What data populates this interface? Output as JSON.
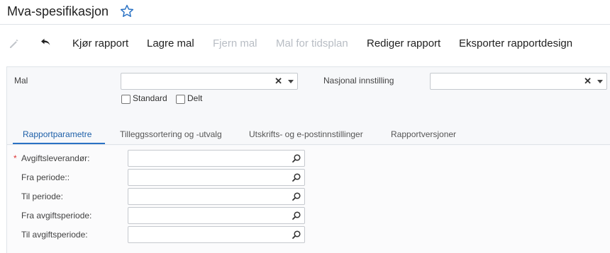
{
  "page": {
    "title": "Mva-spesifikasjon"
  },
  "toolbar": {
    "run": "Kjør rapport",
    "save_template": "Lagre mal",
    "remove_template": "Fjern mal",
    "schedule_template": "Mal for tidsplan",
    "edit_report": "Rediger rapport",
    "export_design": "Eksporter rapportdesign"
  },
  "header_fields": {
    "template_label": "Mal",
    "template_value": "",
    "national_label": "Nasjonal innstilling",
    "national_value": "",
    "standard_label": "Standard",
    "shared_label": "Delt"
  },
  "tabs": [
    {
      "label": "Rapportparametre",
      "active": true
    },
    {
      "label": "Tilleggssortering og -utvalg",
      "active": false
    },
    {
      "label": "Utskrifts- og e-postinnstillinger",
      "active": false
    },
    {
      "label": "Rapportversjoner",
      "active": false
    }
  ],
  "params": [
    {
      "label": "Avgiftsleverandør:",
      "required": true,
      "value": ""
    },
    {
      "label": "Fra periode::",
      "required": false,
      "value": ""
    },
    {
      "label": "Til periode:",
      "required": false,
      "value": ""
    },
    {
      "label": "Fra avgiftsperiode:",
      "required": false,
      "value": ""
    },
    {
      "label": "Til avgiftsperiode:",
      "required": false,
      "value": ""
    }
  ],
  "colors": {
    "accent": "#2a72c4",
    "required": "#dd3333",
    "disabled_text": "#b8bdc4"
  }
}
